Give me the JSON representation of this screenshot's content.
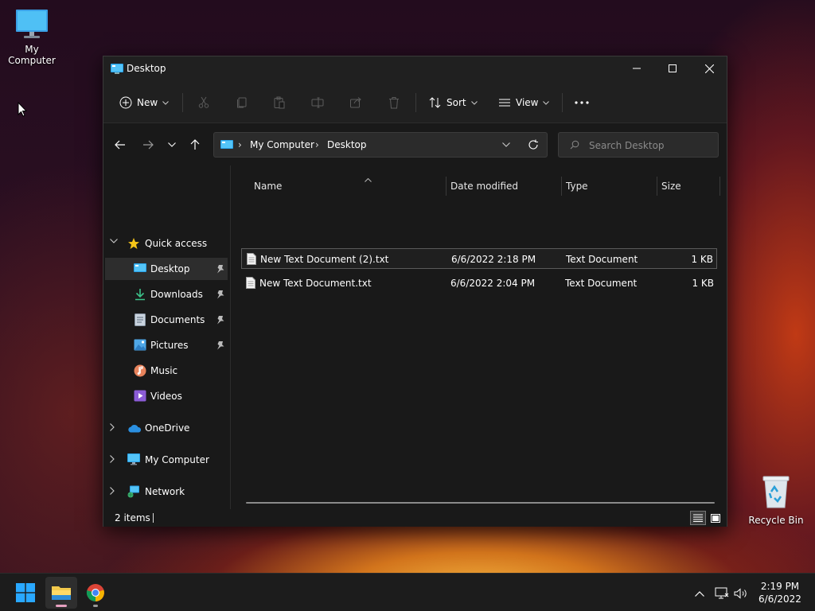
{
  "desktop": {
    "icons": [
      {
        "label": "My Computer"
      },
      {
        "label": "Recycle Bin"
      }
    ]
  },
  "window": {
    "title": "Desktop",
    "commandbar": {
      "new_label": "New",
      "sort_label": "Sort",
      "view_label": "View"
    },
    "address": {
      "crumbs": [
        "My Computer",
        "Desktop"
      ]
    },
    "search": {
      "placeholder": "Search Desktop"
    },
    "sidebar": {
      "quick_access": "Quick access",
      "items": [
        {
          "label": "Desktop",
          "pinned": true,
          "active": true
        },
        {
          "label": "Downloads",
          "pinned": true
        },
        {
          "label": "Documents",
          "pinned": true
        },
        {
          "label": "Pictures",
          "pinned": true
        },
        {
          "label": "Music"
        },
        {
          "label": "Videos"
        }
      ],
      "roots": [
        {
          "label": "OneDrive"
        },
        {
          "label": "My Computer"
        },
        {
          "label": "Network"
        }
      ]
    },
    "columns": [
      "Name",
      "Date modified",
      "Type",
      "Size"
    ],
    "files": [
      {
        "name": "New Text Document (2).txt",
        "modified": "6/6/2022 2:18 PM",
        "type": "Text Document",
        "size": "1 KB"
      },
      {
        "name": "New Text Document.txt",
        "modified": "6/6/2022 2:04 PM",
        "type": "Text Document",
        "size": "1 KB"
      }
    ],
    "status": {
      "item_count": "2 items"
    }
  },
  "taskbar": {
    "clock": {
      "time": "2:19 PM",
      "date": "6/6/2022"
    }
  },
  "colors": {
    "accent": "#0078d4",
    "folder_yellow": "#f2c94c",
    "window_bg": "#191919"
  },
  "icons": [
    "windows-start-icon",
    "file-explorer-icon",
    "chrome-icon",
    "recycle-bin-icon",
    "monitor-icon"
  ]
}
